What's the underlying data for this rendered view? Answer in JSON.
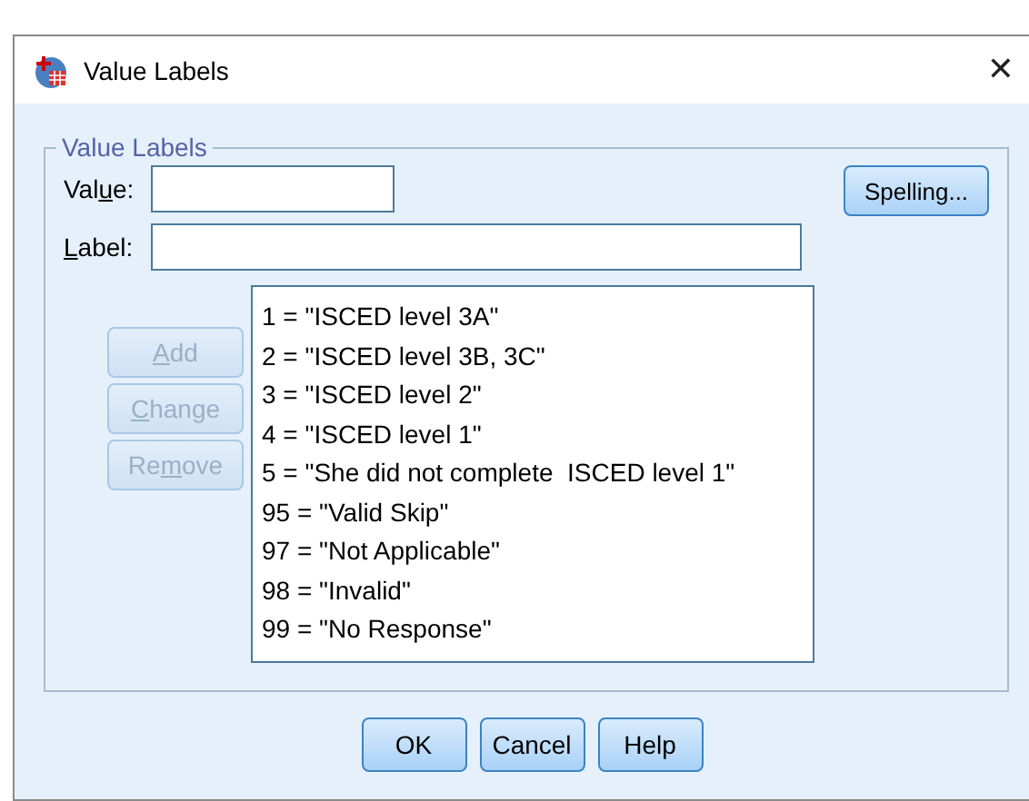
{
  "window": {
    "title": "Value Labels",
    "close": "✕"
  },
  "group": {
    "title": "Value Labels",
    "value_field": {
      "label": {
        "before": "Val",
        "key": "u",
        "after": "e:"
      }
    },
    "label_field": {
      "label": {
        "key": "L",
        "after": "abel:"
      }
    },
    "spelling_button": {
      "label": "Spelling...",
      "disabled": false
    },
    "side_buttons": [
      {
        "key": "A",
        "after": "dd",
        "disabled": true
      },
      {
        "key": "C",
        "after": "hange",
        "disabled": true
      },
      {
        "before": "Re",
        "key": "m",
        "after": "ove",
        "disabled": true
      }
    ],
    "list": [
      {
        "text": "1 = \"ISCED level 3A\"",
        "selected": false
      },
      {
        "text": "2 = \"ISCED level 3B, 3C\"",
        "selected": false
      },
      {
        "text": "3 = \"ISCED level 2\"",
        "selected": false
      },
      {
        "text": "4 = \"ISCED level 1\"",
        "selected": false
      },
      {
        "text": "5 = \"She did not complete  ISCED level 1\"",
        "selected": false
      },
      {
        "text": "95 = \"Valid Skip\"",
        "selected": false
      },
      {
        "text": "97 = \"Not Applicable\"",
        "selected": false
      },
      {
        "text": "98 = \"Invalid\"",
        "selected": false
      },
      {
        "text": "99 = \"No Response\"",
        "selected": false
      }
    ]
  },
  "buttons": [
    {
      "label": "OK",
      "disabled": false
    },
    {
      "label": "Cancel",
      "disabled": false
    },
    {
      "label": "Help",
      "disabled": false
    }
  ]
}
